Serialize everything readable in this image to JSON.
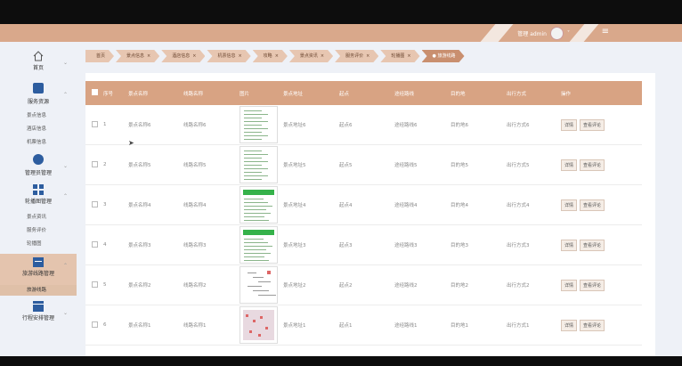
{
  "header": {
    "username": "管理 admin",
    "user_chevron": "˅",
    "menu_glyph": "≡"
  },
  "sidebar": {
    "home": {
      "label": "首页",
      "icon": "home-icon"
    },
    "groups": [
      {
        "label": "服务资源",
        "icon": "square-icon",
        "color": "#2d5d9f",
        "items": [
          "景点信息",
          "酒店信息",
          "机票信息"
        ]
      },
      {
        "label": "管理员管理",
        "icon": "circle-icon",
        "color": "#2d5d9f",
        "items": []
      },
      {
        "label": "轮播图管理",
        "icon": "grid-icon",
        "color": "#2d5d9f",
        "items": [
          "景点资讯",
          "服务评价",
          "轮播图"
        ]
      },
      {
        "label": "旅游线路管理",
        "icon": "calendar-icon",
        "color": "#2d5d9f",
        "items": [
          "旅游线路"
        ]
      },
      {
        "label": "行程安排管理",
        "icon": "window-icon",
        "color": "#2d5d9f",
        "items": []
      }
    ]
  },
  "tabs": [
    {
      "label": "首页",
      "closable": false,
      "active": false
    },
    {
      "label": "景点信息",
      "closable": true,
      "active": false
    },
    {
      "label": "酒店信息",
      "closable": true,
      "active": false
    },
    {
      "label": "机票信息",
      "closable": true,
      "active": false
    },
    {
      "label": "攻略",
      "closable": true,
      "active": false
    },
    {
      "label": "景点资讯",
      "closable": true,
      "active": false
    },
    {
      "label": "服务评价",
      "closable": true,
      "active": false
    },
    {
      "label": "轮播图",
      "closable": true,
      "active": false
    },
    {
      "label": "● 旅游线路",
      "closable": false,
      "active": true
    }
  ],
  "table": {
    "columns": [
      "序号",
      "景点名称",
      "线路名称",
      "图片",
      "景点地址",
      "起点",
      "途经路线",
      "目的地",
      "出行方式",
      "操作"
    ],
    "rows": [
      {
        "no": "1",
        "name": "景点名称6",
        "route": "线路名称6",
        "img": "text",
        "addr": "景点地址6",
        "start": "起点6",
        "via": "途经路线6",
        "dest": "目的地6",
        "mode": "出行方式6"
      },
      {
        "no": "2",
        "name": "景点名称5",
        "route": "线路名称5",
        "img": "text",
        "addr": "景点地址5",
        "start": "起点5",
        "via": "途经路线5",
        "dest": "目的地5",
        "mode": "出行方式5"
      },
      {
        "no": "3",
        "name": "景点名称4",
        "route": "线路名称4",
        "img": "green",
        "addr": "景点地址4",
        "start": "起点4",
        "via": "途经路线4",
        "dest": "目的地4",
        "mode": "出行方式4"
      },
      {
        "no": "4",
        "name": "景点名称3",
        "route": "线路名称3",
        "img": "green",
        "addr": "景点地址3",
        "start": "起点3",
        "via": "途经路线3",
        "dest": "目的地3",
        "mode": "出行方式3"
      },
      {
        "no": "5",
        "name": "景点名称2",
        "route": "线路名称2",
        "img": "diagram",
        "addr": "景点地址2",
        "start": "起点2",
        "via": "途经路线2",
        "dest": "目的地2",
        "mode": "出行方式2"
      },
      {
        "no": "6",
        "name": "景点名称1",
        "route": "线路名称1",
        "img": "map",
        "addr": "景点地址1",
        "start": "起点1",
        "via": "途经路线1",
        "dest": "目的地1",
        "mode": "出行方式1"
      }
    ],
    "actions": [
      "详情",
      "查看评论"
    ]
  },
  "colors": {
    "header": "#d9a88b",
    "table_head": "#d8a383",
    "active_tab": "#c98f6f",
    "accent_blue": "#2d5d9f"
  }
}
